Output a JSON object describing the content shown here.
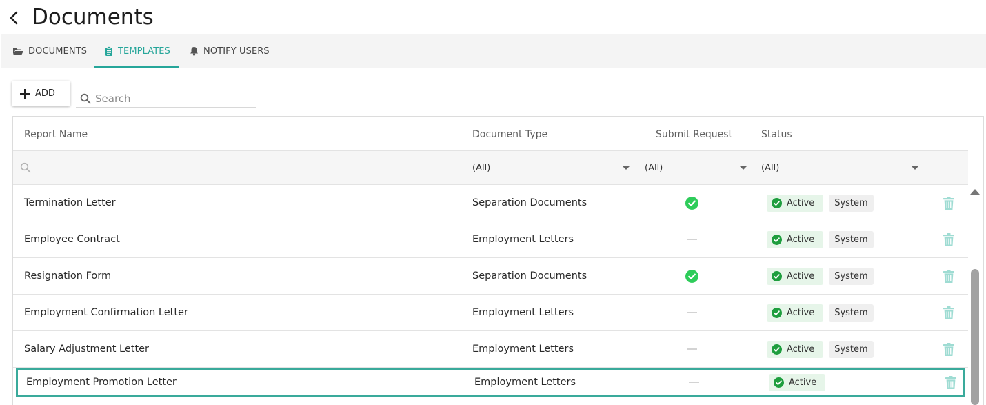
{
  "header": {
    "title": "Documents"
  },
  "tabs": [
    {
      "label": "DOCUMENTS",
      "icon": "folder-open-icon",
      "active": false
    },
    {
      "label": "TEMPLATES",
      "icon": "clipboard-icon",
      "active": true
    },
    {
      "label": "NOTIFY USERS",
      "icon": "bell-icon",
      "active": false
    }
  ],
  "toolbar": {
    "add_label": "ADD",
    "search_placeholder": "Search",
    "search_value": ""
  },
  "table": {
    "columns": [
      "Report Name",
      "Document Type",
      "Submit Request",
      "Status"
    ],
    "filters": {
      "document_type": "(All)",
      "submit_request": "(All)",
      "status": "(All)",
      "name_search": ""
    },
    "rows": [
      {
        "name": "Termination Letter",
        "type": "Separation Documents",
        "submit_request": true,
        "status": "Active",
        "tag": "System"
      },
      {
        "name": "Employee Contract",
        "type": "Employment Letters",
        "submit_request": false,
        "status": "Active",
        "tag": "System"
      },
      {
        "name": "Resignation Form",
        "type": "Separation Documents",
        "submit_request": true,
        "status": "Active",
        "tag": "System"
      },
      {
        "name": "Employment Confirmation Letter",
        "type": "Employment Letters",
        "submit_request": false,
        "status": "Active",
        "tag": "System"
      },
      {
        "name": "Salary Adjustment Letter",
        "type": "Employment Letters",
        "submit_request": false,
        "status": "Active",
        "tag": "System"
      },
      {
        "name": "Employment Promotion Letter",
        "type": "Employment Letters",
        "submit_request": false,
        "status": "Active",
        "tag": "",
        "selected": true
      }
    ]
  },
  "colors": {
    "accent": "#26a69a",
    "active_check": "#1e9e3e",
    "submit_check": "#2ecc5a",
    "delete_icon": "#9fdcd3",
    "selected_border": "#3aaa9b"
  }
}
